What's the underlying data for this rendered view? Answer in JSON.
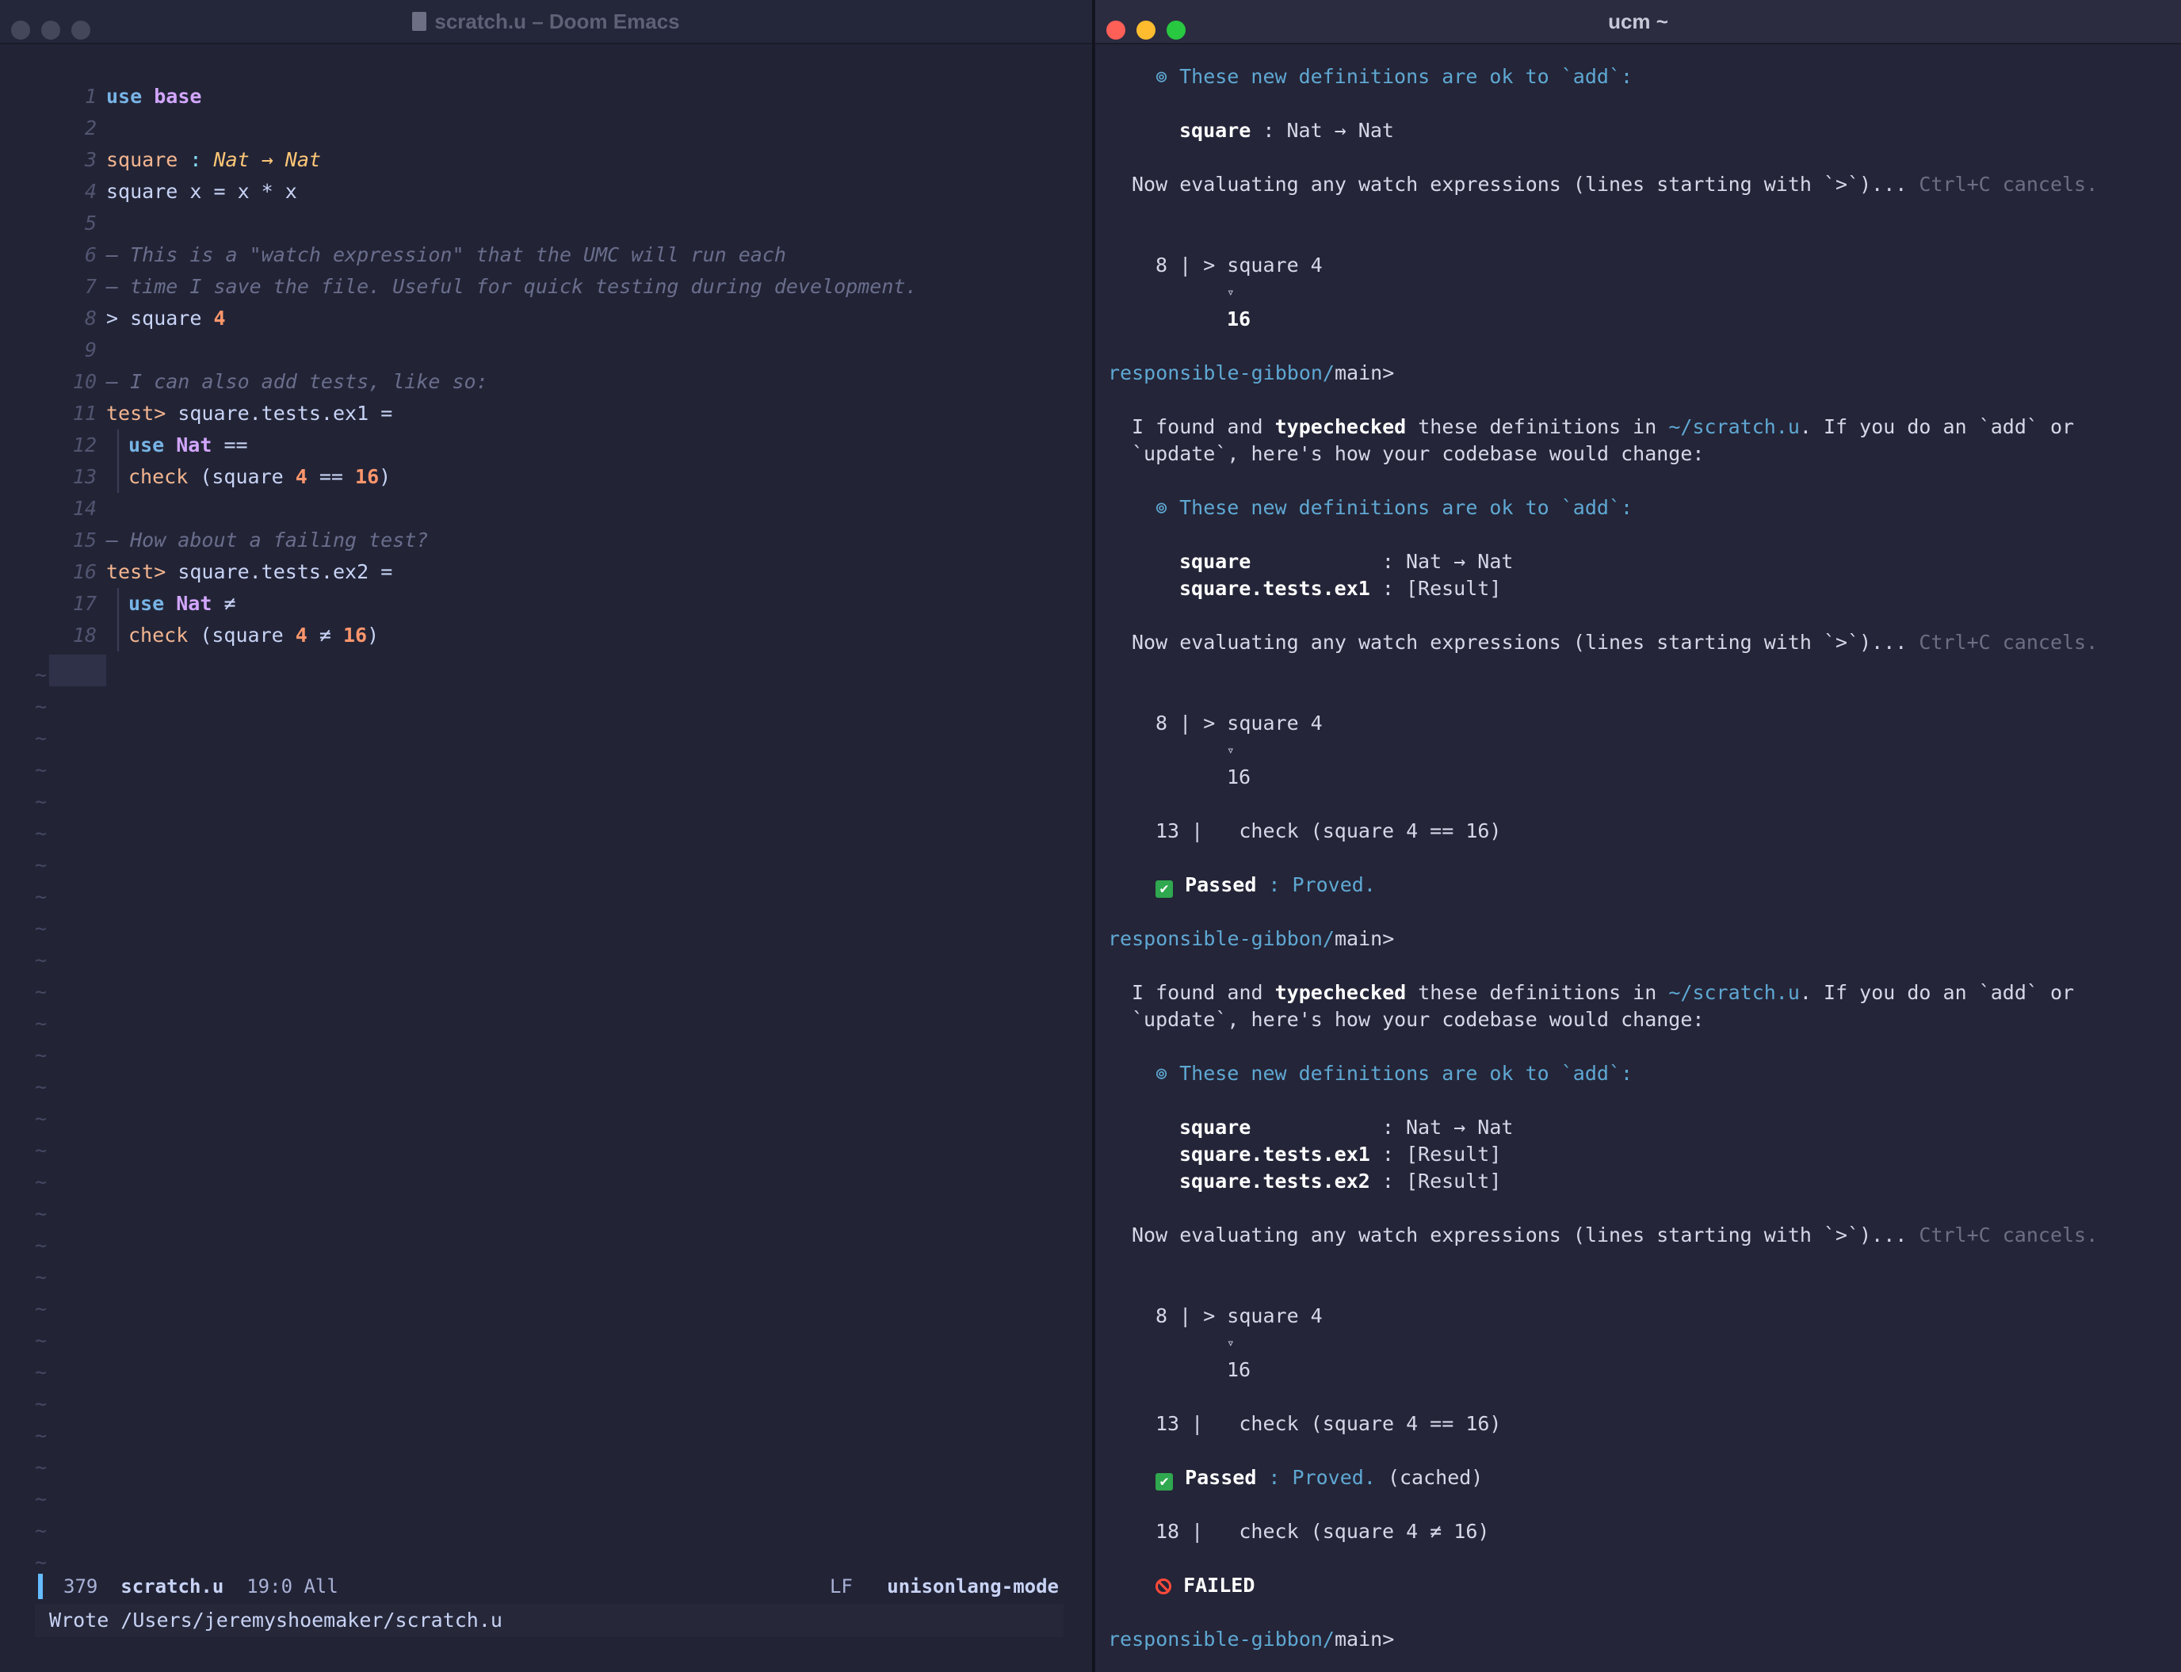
{
  "emacs": {
    "title": "scratch.u – Doom Emacs",
    "lines": [
      {
        "n": "1",
        "kw": "use",
        "mod": "base"
      },
      {
        "n": "2"
      },
      {
        "n": "3",
        "name": "square",
        "sig_colon": ":",
        "sig": "Nat → Nat"
      },
      {
        "n": "4",
        "text": "square x = x * x"
      },
      {
        "n": "5"
      },
      {
        "n": "6",
        "comment": "— This is a \"watch expression\" that the UMC will run each"
      },
      {
        "n": "7",
        "comment": "— time I save the file. Useful for quick testing during development."
      },
      {
        "n": "8",
        "watch": "> square ",
        "num": "4"
      },
      {
        "n": "9"
      },
      {
        "n": "10",
        "comment": "— I can also add tests, like so:"
      },
      {
        "n": "11",
        "test": "test>",
        "rest": " square.tests.ex1 ="
      },
      {
        "n": "12",
        "kw": "use",
        "mod": "Nat",
        "op": "=="
      },
      {
        "n": "13",
        "fn": "check",
        "pre": " (square ",
        "num": "4",
        "op": " == ",
        "num2": "16",
        "post": ")"
      },
      {
        "n": "14"
      },
      {
        "n": "15",
        "comment": "— How about a failing test?"
      },
      {
        "n": "16",
        "test": "test>",
        "rest": " square.tests.ex2 ="
      },
      {
        "n": "17",
        "kw": "use",
        "mod": "Nat",
        "op": "≠"
      },
      {
        "n": "18",
        "fn": "check",
        "pre": " (square ",
        "num": "4",
        "op": " ≠ ",
        "num2": "16",
        "post": ")"
      }
    ],
    "tilde": "~",
    "modeline": {
      "left_num": "379",
      "file": "scratch.u",
      "pos": "19:0 All",
      "eol": "LF",
      "mode": "unisonlang-mode"
    },
    "echo": "Wrote /Users/jeremyshoemaker/scratch.u"
  },
  "terminal": {
    "title": "ucm ~",
    "ok_header": "⊚ These new definitions are ok to `add`:",
    "sq_def": "square",
    "sq_def_pad": "square          ",
    "sig": " : Nat → Nat",
    "ex1": "square.tests.ex1",
    "ex2": "square.tests.ex2",
    "result_sig": " : [Result]",
    "eval": "Now evaluating any watch expressions (lines starting with `>`)... ",
    "cancels": "Ctrl+C cancels.",
    "watch_line": "8 | > square 4",
    "tri": "▿",
    "sixteen": "16",
    "prompt_path": "responsible-gibbon/",
    "prompt_branch": "main>",
    "found_a": "I found and ",
    "found_b": "typechecked",
    "found_c": " these definitions in ",
    "found_d": "~/scratch.u",
    "found_e": ". If you do an `add` or",
    "found_2": "`update`, here's how your codebase would change:",
    "check13": "13 |   check (square 4 == 16)",
    "check18": "18 |   check (square 4 ≠ 16)",
    "passed": "Passed",
    "proved": " : Proved.",
    "cached": " (cached)",
    "check_mark": "✔",
    "failed": "FAILED"
  }
}
